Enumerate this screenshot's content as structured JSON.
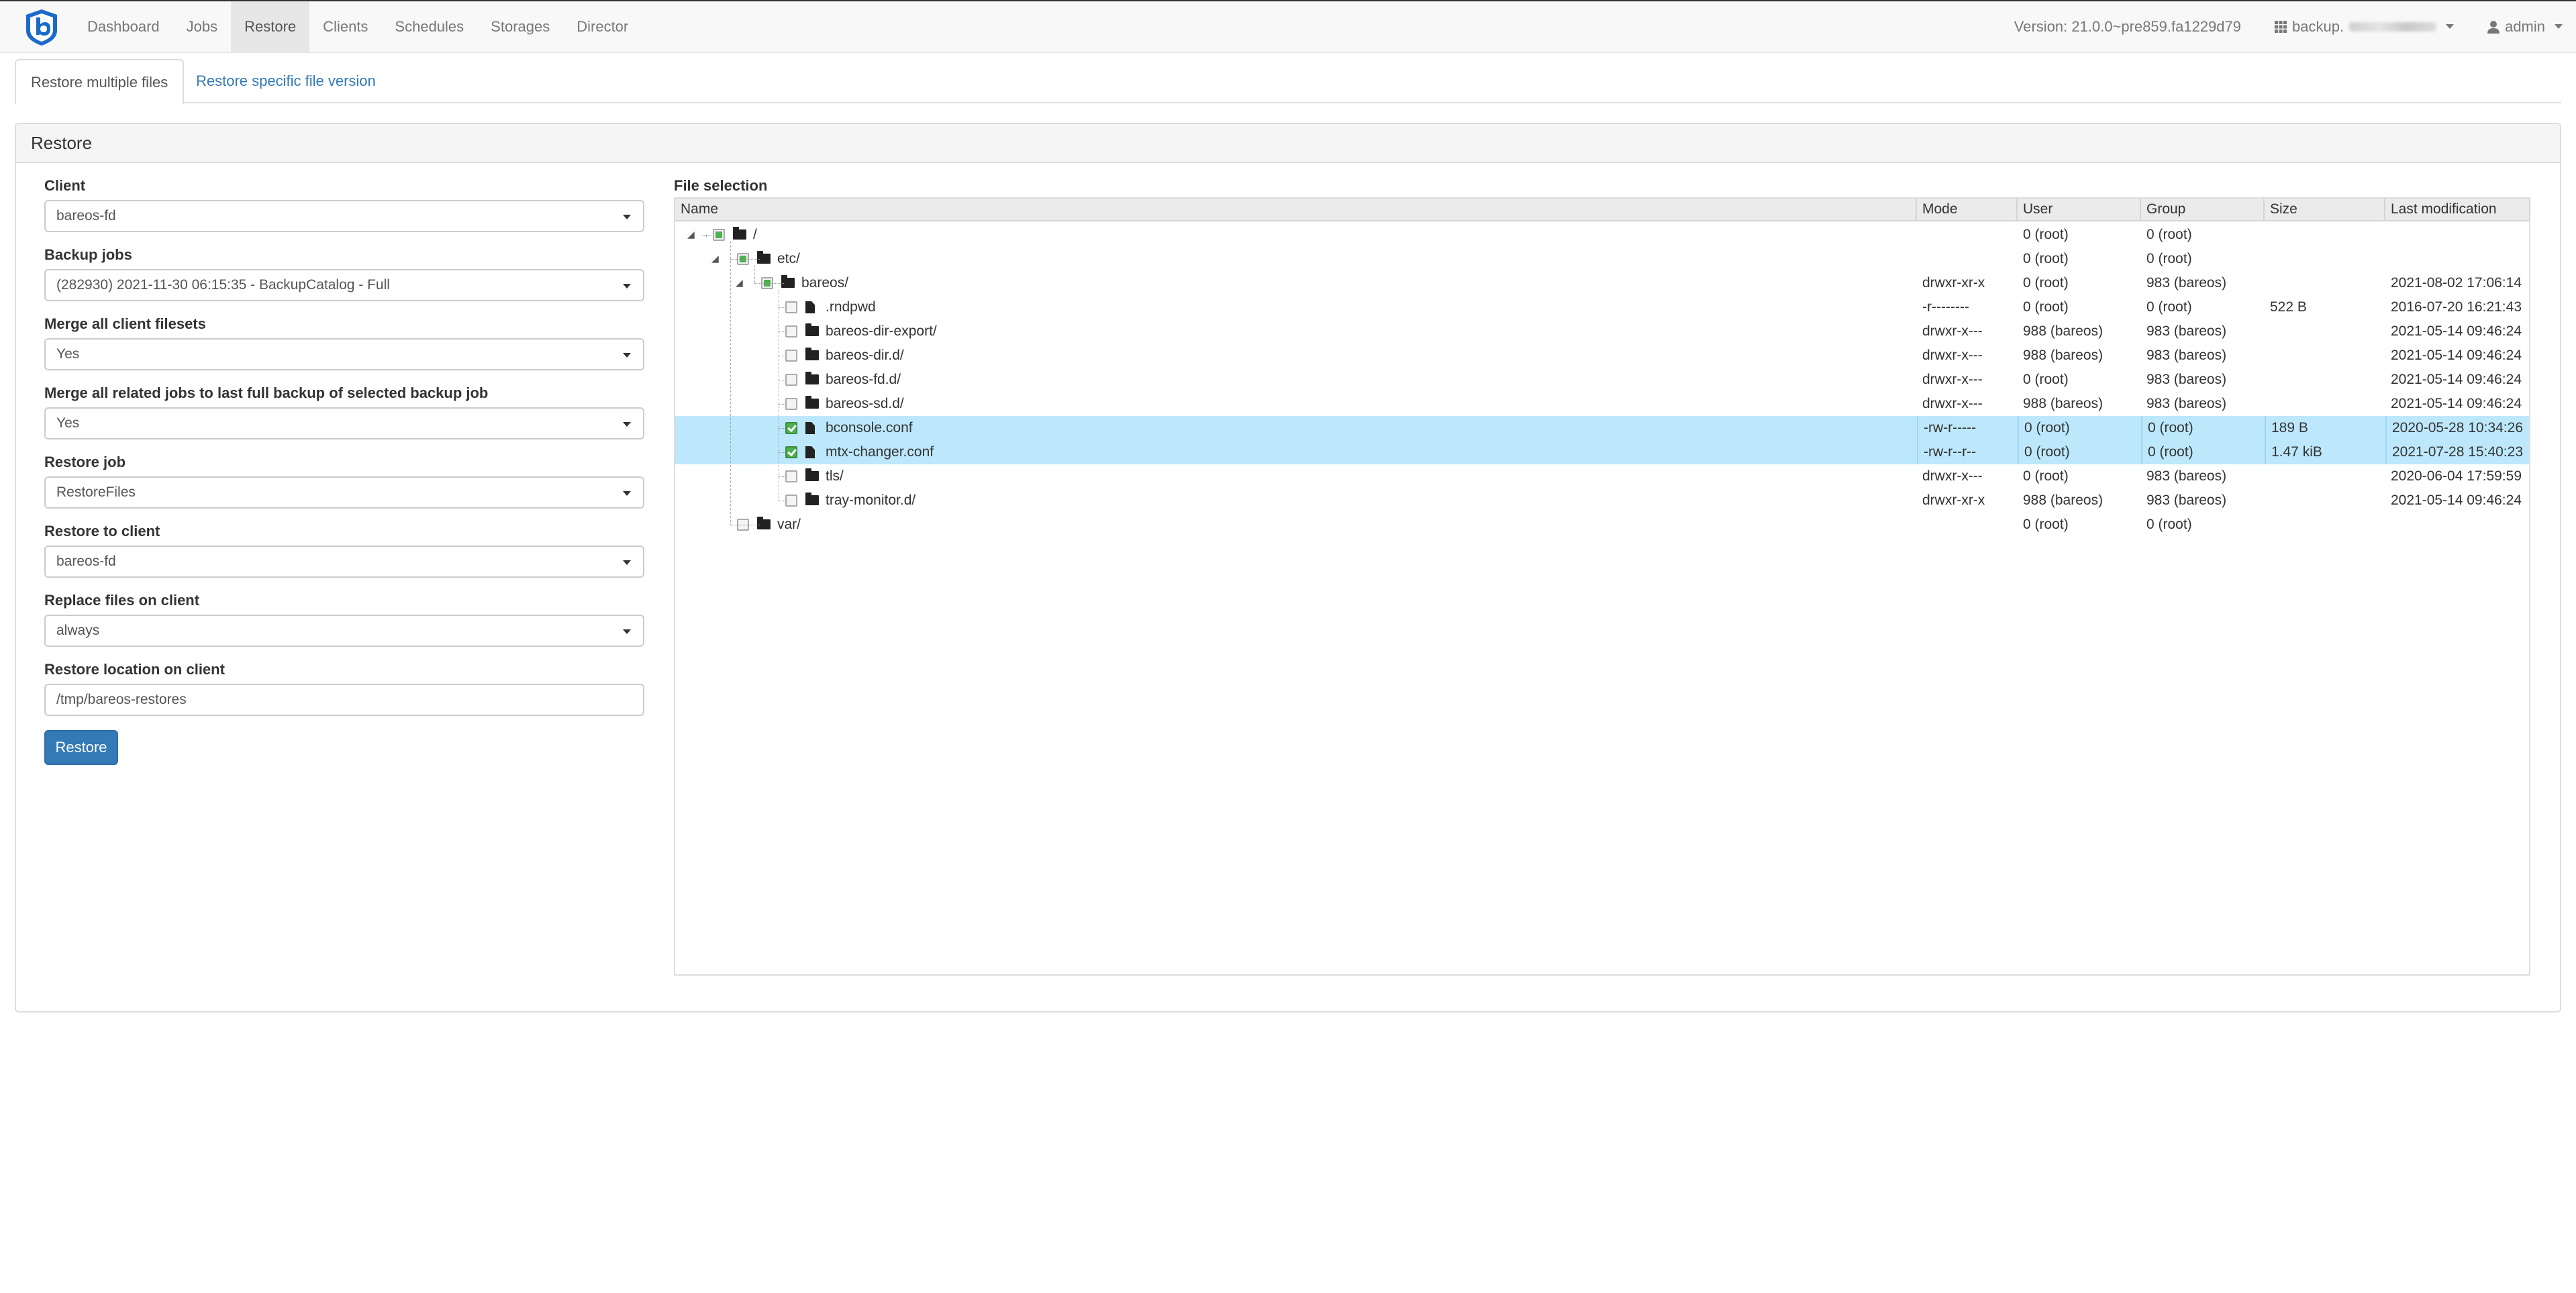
{
  "nav": {
    "items": [
      "Dashboard",
      "Jobs",
      "Restore",
      "Clients",
      "Schedules",
      "Storages",
      "Director"
    ],
    "active": "Restore",
    "version": "Version: 21.0.0~pre859.fa1229d79",
    "director_label": "backup.",
    "user": "admin"
  },
  "tabs": {
    "multiple": "Restore multiple files",
    "specific": "Restore specific file version"
  },
  "panel": {
    "title": "Restore"
  },
  "form": {
    "client_label": "Client",
    "client_value": "bareos-fd",
    "backup_jobs_label": "Backup jobs",
    "backup_jobs_value": "(282930) 2021-11-30 06:15:35 - BackupCatalog - Full",
    "merge_filesets_label": "Merge all client filesets",
    "merge_filesets_value": "Yes",
    "merge_jobs_label": "Merge all related jobs to last full backup of selected backup job",
    "merge_jobs_value": "Yes",
    "restore_job_label": "Restore job",
    "restore_job_value": "RestoreFiles",
    "restore_client_label": "Restore to client",
    "restore_client_value": "bareos-fd",
    "replace_label": "Replace files on client",
    "replace_value": "always",
    "location_label": "Restore location on client",
    "location_value": "/tmp/bareos-restores",
    "restore_button": "Restore"
  },
  "file_selection": {
    "title": "File selection",
    "columns": [
      "Name",
      "Mode",
      "User",
      "Group",
      "Size",
      "Last modification"
    ],
    "rows": [
      {
        "name": "/",
        "mode": "",
        "user": "0 (root)",
        "group": "0 (root)",
        "size": "",
        "mtime": "",
        "type": "folder",
        "depth": 0,
        "check": "partial",
        "selected": false
      },
      {
        "name": "etc/",
        "mode": "",
        "user": "0 (root)",
        "group": "0 (root)",
        "size": "",
        "mtime": "",
        "type": "folder",
        "depth": 1,
        "check": "partial",
        "selected": false
      },
      {
        "name": "bareos/",
        "mode": "drwxr-xr-x",
        "user": "0 (root)",
        "group": "983 (bareos)",
        "size": "",
        "mtime": "2021-08-02 17:06:14",
        "type": "folder",
        "depth": 2,
        "check": "partial",
        "selected": false
      },
      {
        "name": ".rndpwd",
        "mode": "-r--------",
        "user": "0 (root)",
        "group": "0 (root)",
        "size": "522 B",
        "mtime": "2016-07-20 16:21:43",
        "type": "file",
        "depth": 3,
        "check": "none",
        "selected": false
      },
      {
        "name": "bareos-dir-export/",
        "mode": "drwxr-x---",
        "user": "988 (bareos)",
        "group": "983 (bareos)",
        "size": "",
        "mtime": "2021-05-14 09:46:24",
        "type": "folder",
        "depth": 3,
        "check": "none",
        "selected": false
      },
      {
        "name": "bareos-dir.d/",
        "mode": "drwxr-x---",
        "user": "988 (bareos)",
        "group": "983 (bareos)",
        "size": "",
        "mtime": "2021-05-14 09:46:24",
        "type": "folder",
        "depth": 3,
        "check": "none",
        "selected": false
      },
      {
        "name": "bareos-fd.d/",
        "mode": "drwxr-x---",
        "user": "0 (root)",
        "group": "983 (bareos)",
        "size": "",
        "mtime": "2021-05-14 09:46:24",
        "type": "folder",
        "depth": 3,
        "check": "none",
        "selected": false
      },
      {
        "name": "bareos-sd.d/",
        "mode": "drwxr-x---",
        "user": "988 (bareos)",
        "group": "983 (bareos)",
        "size": "",
        "mtime": "2021-05-14 09:46:24",
        "type": "folder",
        "depth": 3,
        "check": "none",
        "selected": false
      },
      {
        "name": "bconsole.conf",
        "mode": "-rw-r-----",
        "user": "0 (root)",
        "group": "0 (root)",
        "size": "189 B",
        "mtime": "2020-05-28 10:34:26",
        "type": "file",
        "depth": 3,
        "check": "checked",
        "selected": true
      },
      {
        "name": "mtx-changer.conf",
        "mode": "-rw-r--r--",
        "user": "0 (root)",
        "group": "0 (root)",
        "size": "1.47 kiB",
        "mtime": "2021-07-28 15:40:23",
        "type": "file",
        "depth": 3,
        "check": "checked",
        "selected": true
      },
      {
        "name": "tls/",
        "mode": "drwxr-x---",
        "user": "0 (root)",
        "group": "983 (bareos)",
        "size": "",
        "mtime": "2020-06-04 17:59:59",
        "type": "folder",
        "depth": 3,
        "check": "none",
        "selected": false
      },
      {
        "name": "tray-monitor.d/",
        "mode": "drwxr-xr-x",
        "user": "988 (bareos)",
        "group": "983 (bareos)",
        "size": "",
        "mtime": "2021-05-14 09:46:24",
        "type": "folder",
        "depth": 3,
        "check": "none",
        "selected": false
      },
      {
        "name": "var/",
        "mode": "",
        "user": "0 (root)",
        "group": "0 (root)",
        "size": "",
        "mtime": "",
        "type": "folder",
        "depth": 1,
        "check": "none",
        "selected": false
      }
    ]
  },
  "colors": {
    "brand": "#1b6ac9",
    "primary": "#337ab7",
    "selected_row": "#bde8fb",
    "check_green": "#4caf50"
  }
}
